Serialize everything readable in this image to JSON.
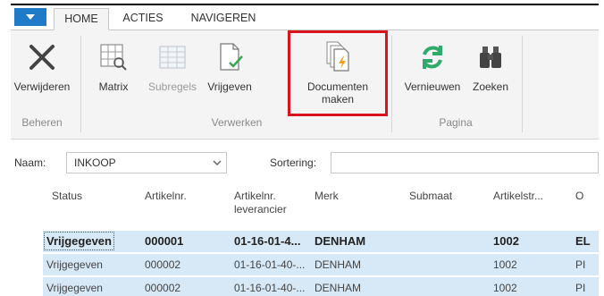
{
  "tabs": {
    "home": "HOME",
    "acties": "ACTIES",
    "navigeren": "NAVIGEREN"
  },
  "ribbon": {
    "verwijderen": "Verwijderen",
    "matrix": "Matrix",
    "subregels": "Subregels",
    "vrijgeven": "Vrijgeven",
    "documenten_line1": "Documenten",
    "documenten_line2": "maken",
    "vernieuwen": "Vernieuwen",
    "zoeken": "Zoeken",
    "groups": {
      "beheren": "Beheren",
      "verwerken": "Verwerken",
      "pagina": "Pagina"
    }
  },
  "filter": {
    "naam_label": "Naam:",
    "naam_value": "INKOOP",
    "sort_label": "Sortering:"
  },
  "grid": {
    "headers": {
      "status": "Status",
      "artikelnr": "Artikelnr.",
      "artikelnr_lev_1": "Artikelnr.",
      "artikelnr_lev_2": "leverancier",
      "merk": "Merk",
      "submaat": "Submaat",
      "artikelstr": "Artikelstr...",
      "o": "O"
    },
    "rows": [
      {
        "status": "Vrijgegeven",
        "artikelnr": "000001",
        "artikelnr_lev": "01-16-01-4...",
        "merk": "DENHAM",
        "submaat": "",
        "artikelstr": "1002",
        "o": "EL"
      },
      {
        "status": "Vrijgegeven",
        "artikelnr": "000002",
        "artikelnr_lev": "01-16-01-40-...",
        "merk": "DENHAM",
        "submaat": "",
        "artikelstr": "1002",
        "o": "PI"
      },
      {
        "status": "Vrijgegeven",
        "artikelnr": "000002",
        "artikelnr_lev": "01-16-01-40-...",
        "merk": "DENHAM",
        "submaat": "",
        "artikelstr": "1002",
        "o": "PI"
      }
    ]
  },
  "colors": {
    "accent": "#1f7bc8",
    "highlight": "#d9141e",
    "row_selected": "#d7e8f6",
    "refresh": "#2eaa6a",
    "lightning": "#f0a020"
  }
}
